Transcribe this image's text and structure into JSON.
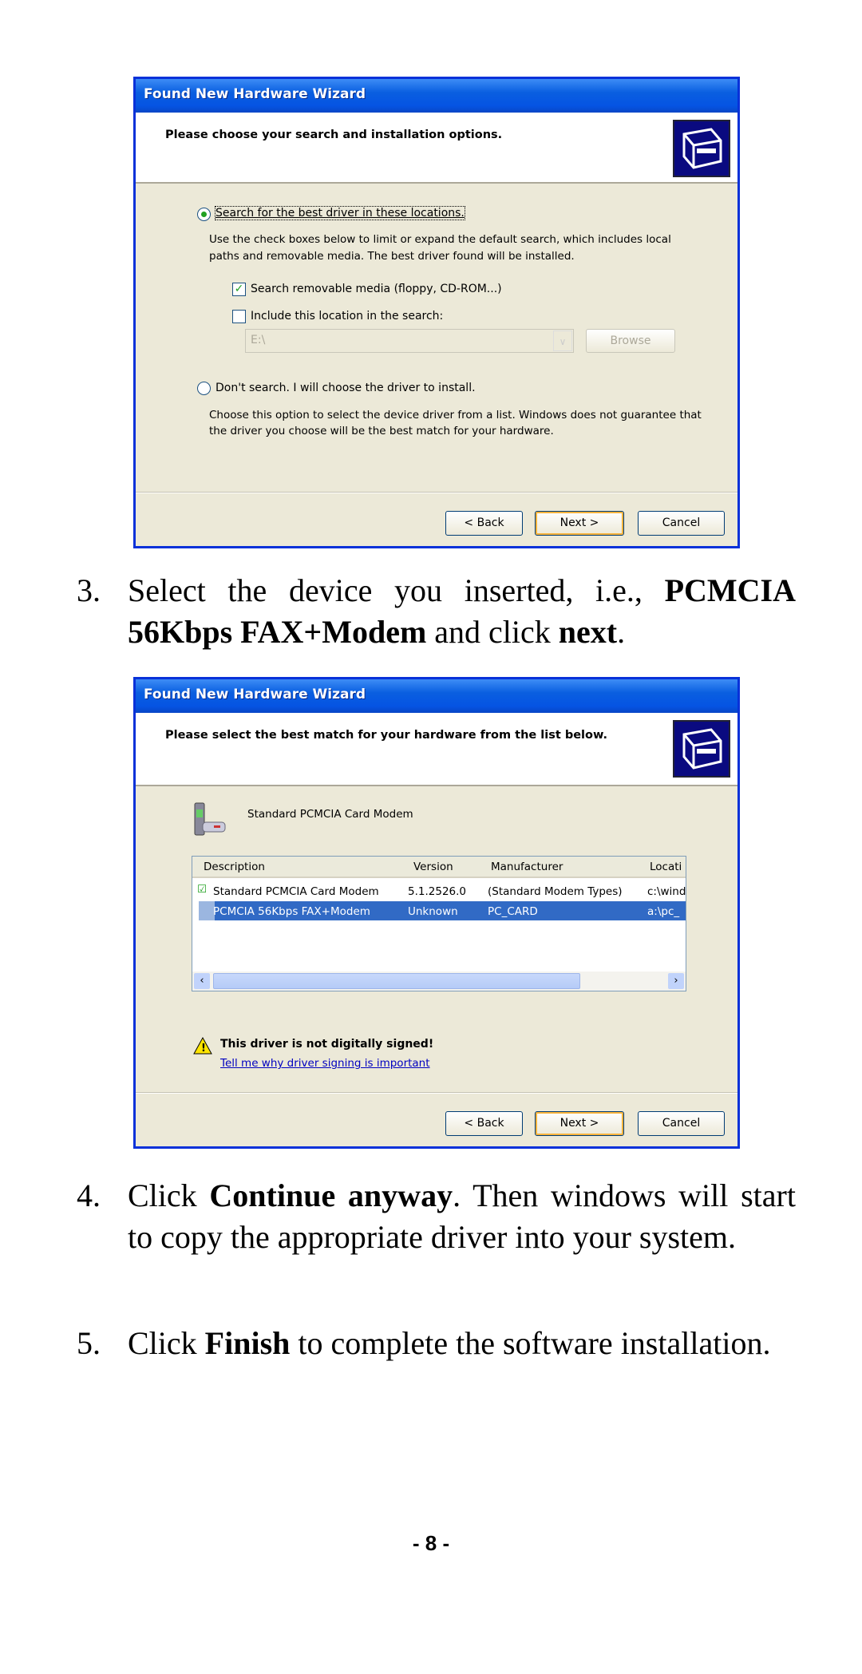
{
  "dialog1": {
    "title": "Found New Hardware Wizard",
    "header": "Please choose your search and installation options.",
    "radio_search": "Search for the best driver in these locations.",
    "search_desc_1": "Use the check boxes below to limit or expand the default search, which includes local",
    "search_desc_2": "paths and removable media. The best driver found will be installed.",
    "check_removable": "Search removable media (floppy, CD-ROM...)",
    "check_removable_checked": true,
    "check_location": "Include this location in the search:",
    "check_location_checked": false,
    "location_value": "E:\\",
    "browse": "Browse",
    "radio_dont": "Don't search. I will choose the driver to install.",
    "dont_desc_1": "Choose this option to select the device driver from a list.  Windows does not guarantee that",
    "dont_desc_2": "the driver you choose will be the best match for your hardware.",
    "back": "< Back",
    "next": "Next >",
    "cancel": "Cancel"
  },
  "step3": {
    "num": "3.",
    "pre": "Select the device you inserted, i.e., ",
    "bold1": "PCMCIA 56Kbps FAX+Modem",
    "mid": " and click ",
    "bold2": "next",
    "post": "."
  },
  "dialog2": {
    "title": "Found New Hardware Wizard",
    "header": "Please select the best match for your hardware from the list below.",
    "device": "Standard PCMCIA Card Modem",
    "columns": [
      "Description",
      "Version",
      "Manufacturer",
      "Locati"
    ],
    "rows": [
      [
        "Standard PCMCIA Card Modem",
        "5.1.2526.0",
        "(Standard Modem Types)",
        "c:\\wind"
      ],
      [
        "PCMCIA 56Kbps FAX+Modem",
        "Unknown",
        "PC_CARD",
        "a:\\pc_"
      ]
    ],
    "selected_row": 1,
    "warning": "This driver is not digitally signed!",
    "link": "Tell me why driver signing is important",
    "back": "< Back",
    "next": "Next >",
    "cancel": "Cancel"
  },
  "step4": {
    "num": "4.",
    "pre": "Click ",
    "bold": "Continue anyway",
    "post": ".  Then windows will start to copy the appropriate driver into your system."
  },
  "step5": {
    "num": "5.",
    "pre": "Click ",
    "bold": "Finish",
    "post": " to complete the software installation."
  },
  "page_number": "- 8 -"
}
